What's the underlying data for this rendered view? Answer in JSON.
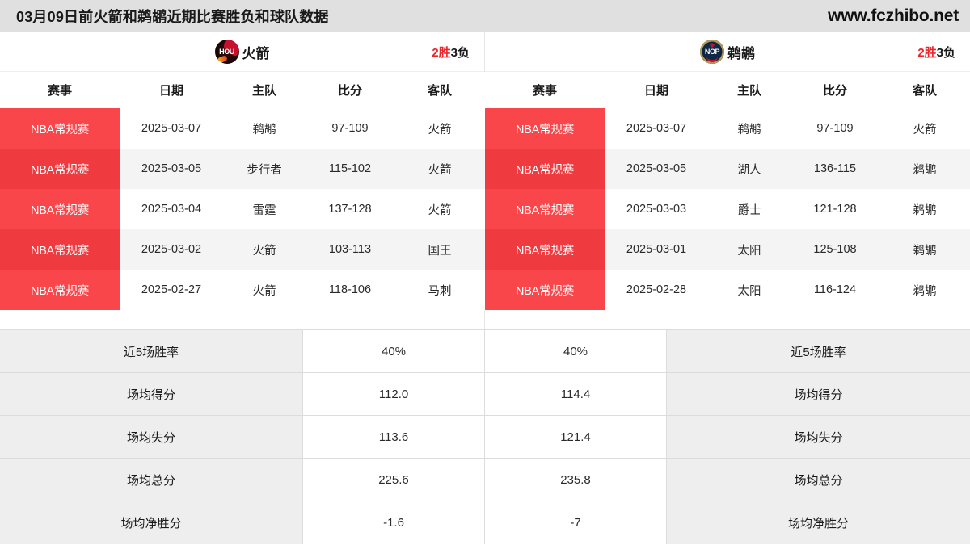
{
  "titlebar": {
    "title": "03月09日前火箭和鹈鹕近期比赛胜负和球队数据",
    "site": "www.fczhibo.net"
  },
  "panels": [
    {
      "side": "left",
      "logo": "rockets-logo",
      "logo_mono": "HOU",
      "team_name": "火箭",
      "record_win": "2胜",
      "record_loss": "3负",
      "columns": [
        "赛事",
        "日期",
        "主队",
        "比分",
        "客队"
      ],
      "rows": [
        {
          "league": "NBA常规赛",
          "date": "2025-03-07",
          "home": "鹈鹕",
          "score": "97-109",
          "away": "火箭"
        },
        {
          "league": "NBA常规赛",
          "date": "2025-03-05",
          "home": "步行者",
          "score": "115-102",
          "away": "火箭"
        },
        {
          "league": "NBA常规赛",
          "date": "2025-03-04",
          "home": "雷霆",
          "score": "137-128",
          "away": "火箭"
        },
        {
          "league": "NBA常规赛",
          "date": "2025-03-02",
          "home": "火箭",
          "score": "103-113",
          "away": "国王"
        },
        {
          "league": "NBA常规赛",
          "date": "2025-02-27",
          "home": "火箭",
          "score": "118-106",
          "away": "马刺"
        }
      ]
    },
    {
      "side": "right",
      "logo": "pelicans-logo",
      "logo_mono": "NOP",
      "team_name": "鹈鹕",
      "record_win": "2胜",
      "record_loss": "3负",
      "columns": [
        "赛事",
        "日期",
        "主队",
        "比分",
        "客队"
      ],
      "rows": [
        {
          "league": "NBA常规赛",
          "date": "2025-03-07",
          "home": "鹈鹕",
          "score": "97-109",
          "away": "火箭"
        },
        {
          "league": "NBA常规赛",
          "date": "2025-03-05",
          "home": "湖人",
          "score": "136-115",
          "away": "鹈鹕"
        },
        {
          "league": "NBA常规赛",
          "date": "2025-03-03",
          "home": "爵士",
          "score": "121-128",
          "away": "鹈鹕"
        },
        {
          "league": "NBA常规赛",
          "date": "2025-03-01",
          "home": "太阳",
          "score": "125-108",
          "away": "鹈鹕"
        },
        {
          "league": "NBA常规赛",
          "date": "2025-02-28",
          "home": "太阳",
          "score": "116-124",
          "away": "鹈鹕"
        }
      ]
    }
  ],
  "stats": [
    {
      "label_left": "近5场胜率",
      "value_left": "40%",
      "value_right": "40%",
      "label_right": "近5场胜率"
    },
    {
      "label_left": "场均得分",
      "value_left": "112.0",
      "value_right": "114.4",
      "label_right": "场均得分"
    },
    {
      "label_left": "场均失分",
      "value_left": "113.6",
      "value_right": "121.4",
      "label_right": "场均失分"
    },
    {
      "label_left": "场均总分",
      "value_left": "225.6",
      "value_right": "235.8",
      "label_right": "场均总分"
    },
    {
      "label_left": "场均净胜分",
      "value_left": "-1.6",
      "value_right": "-7",
      "label_right": "场均净胜分"
    }
  ],
  "colors": {
    "titlebar_bg": "#e0e0e0",
    "league_badge_odd": "#f9464b",
    "league_badge_even": "#ef3a3f",
    "row_alt_bg": "#f4f4f4",
    "stats_label_bg": "#eeeeee",
    "win_text": "#e8272c"
  }
}
